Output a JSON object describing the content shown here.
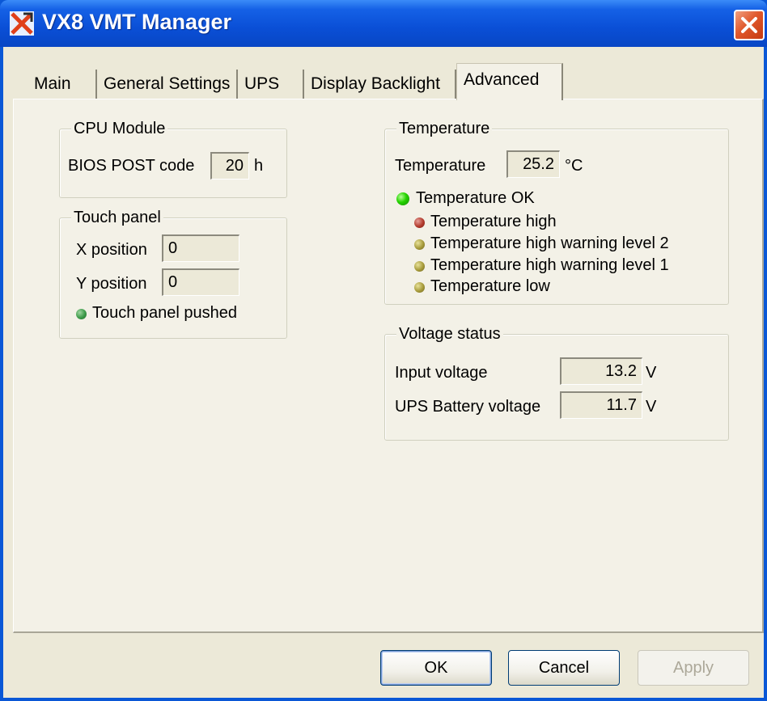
{
  "window": {
    "title": "VX8 VMT Manager"
  },
  "tabs": [
    {
      "label": "Main"
    },
    {
      "label": "General Settings"
    },
    {
      "label": "UPS"
    },
    {
      "label": "Display Backlight"
    },
    {
      "label": "Advanced"
    }
  ],
  "cpu_module": {
    "group_label": "CPU Module",
    "bios_label": "BIOS POST code",
    "bios_value": "20",
    "bios_unit": "h"
  },
  "touch_panel": {
    "group_label": "Touch panel",
    "x_label": "X position",
    "x_value": "0",
    "y_label": "Y position",
    "y_value": "0",
    "pushed_label": "Touch panel pushed"
  },
  "temperature": {
    "group_label": "Temperature",
    "label": "Temperature",
    "value": "25.2",
    "unit": "°C",
    "ok_label": "Temperature OK",
    "high_label": "Temperature high",
    "warn2_label": "Temperature high warning level 2",
    "warn1_label": "Temperature high warning level 1",
    "low_label": "Temperature low"
  },
  "voltage": {
    "group_label": "Voltage status",
    "input_label": "Input voltage",
    "input_value": "13.2",
    "input_unit": "V",
    "ups_label": "UPS Battery voltage",
    "ups_value": "11.7",
    "ups_unit": "V"
  },
  "buttons": {
    "ok": "OK",
    "cancel": "Cancel",
    "apply": "Apply"
  },
  "colors": {
    "title_bar": "#0a57d6",
    "dialog_bg": "#ece9d8",
    "led_ok": "#25d300"
  }
}
